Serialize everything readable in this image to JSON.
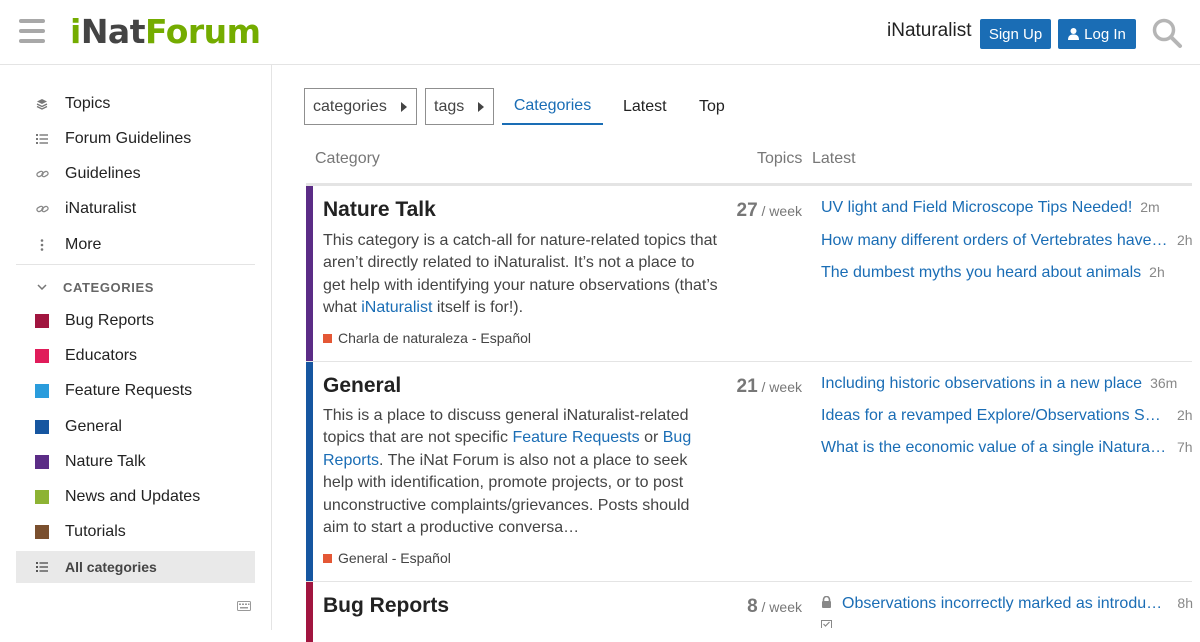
{
  "header": {
    "logo_i": "i",
    "logo_nat": "Nat",
    "logo_forum": "Forum",
    "site_link": "iNaturalist",
    "signup_label": "Sign Up",
    "login_label": "Log In"
  },
  "sidebar": {
    "items": [
      {
        "label": "Topics",
        "icon": "layers-icon"
      },
      {
        "label": "Forum Guidelines",
        "icon": "list-icon"
      },
      {
        "label": "Guidelines",
        "icon": "link-icon"
      },
      {
        "label": "iNaturalist",
        "icon": "link-icon"
      },
      {
        "label": "More",
        "icon": "more-vertical-icon"
      }
    ],
    "categories_heading": "CATEGORIES",
    "categories": [
      {
        "label": "Bug Reports",
        "color": "#a1153f"
      },
      {
        "label": "Educators",
        "color": "#e01c5a"
      },
      {
        "label": "Feature Requests",
        "color": "#2a9cdc"
      },
      {
        "label": "General",
        "color": "#1656a0"
      },
      {
        "label": "Nature Talk",
        "color": "#5b2c86"
      },
      {
        "label": "News and Updates",
        "color": "#8db334"
      },
      {
        "label": "Tutorials",
        "color": "#7a4f2e"
      }
    ],
    "all_categories_label": "All categories"
  },
  "nav": {
    "categories_dropdown": "categories",
    "tags_dropdown": "tags",
    "tabs": [
      "Categories",
      "Latest",
      "Top"
    ],
    "active_tab": "Categories"
  },
  "table": {
    "col_category": "Category",
    "col_topics": "Topics",
    "col_latest": "Latest",
    "rows": [
      {
        "title": "Nature Talk",
        "color": "#5b2c86",
        "desc_1": "This category is a catch-all for nature-related topics that aren’t directly related to iNaturalist. It’s not a place to get help with identifying your nature observations (that’s what ",
        "desc_link": "iNaturalist",
        "desc_2": " itself is for!).",
        "subcategory": "Charla de naturaleza - Español",
        "count": "27",
        "per": "/ week",
        "latest": [
          {
            "title": "UV light and Field Microscope Tips Needed!",
            "age": "2m"
          },
          {
            "title": "How many different orders of Vertebrates have you seen?",
            "age": "2h"
          },
          {
            "title": "The dumbest myths you heard about animals",
            "age": "2h"
          }
        ]
      },
      {
        "title": "General",
        "color": "#1656a0",
        "desc_1": "This is a place to discuss general iNaturalist-related topics that are not specific ",
        "desc_link1": "Feature Requests",
        "desc_or": " or ",
        "desc_link2": "Bug Reports",
        "desc_2": ". The iNat Forum is also not a place to seek help with identification, promote projects, or to post unconstructive complaints/grievances. Posts should aim to start a productive conversa…",
        "subcategory": "General - Español",
        "count": "21",
        "per": "/ week",
        "latest": [
          {
            "title": "Including historic observations in a new place",
            "age": "36m"
          },
          {
            "title": "Ideas for a revamped Explore/Observations Search page",
            "age": "2h"
          },
          {
            "title": "What is the economic value of a single iNaturalist observation?",
            "age": "7h"
          }
        ]
      },
      {
        "title": "Bug Reports",
        "color": "#a1153f",
        "count": "8",
        "per": "/ week",
        "latest": [
          {
            "title": "Observations incorrectly marked as introduced",
            "age": "8h"
          }
        ]
      }
    ]
  }
}
